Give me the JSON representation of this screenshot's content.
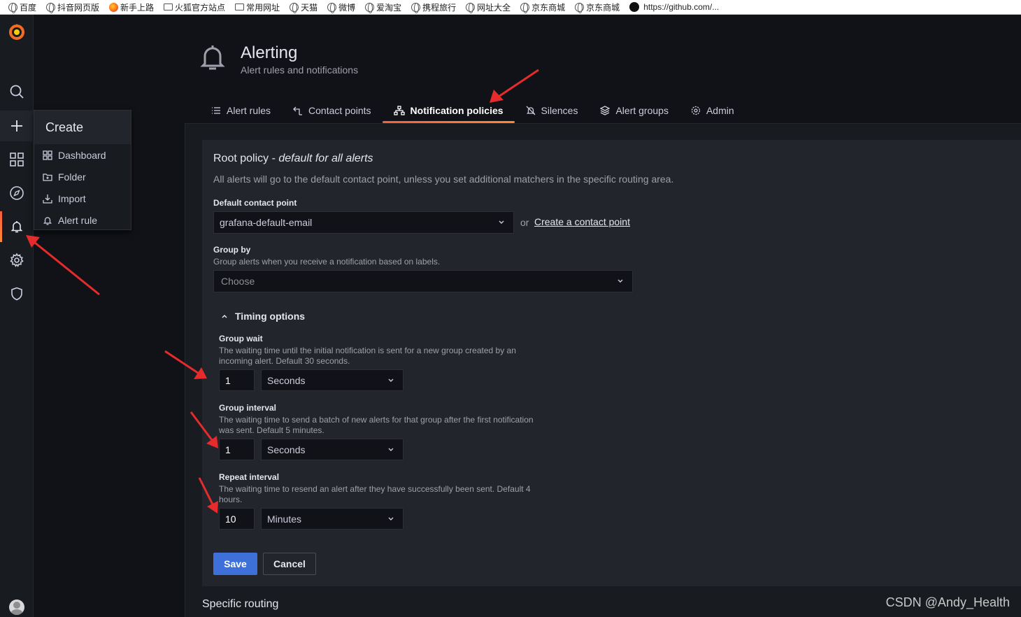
{
  "bookmarks": [
    {
      "label": "百度",
      "icon": "globe-icon"
    },
    {
      "label": "抖音网页版",
      "icon": "globe-icon"
    },
    {
      "label": "新手上路",
      "icon": "firefox-icon"
    },
    {
      "label": "火狐官方站点",
      "icon": "folder-icon"
    },
    {
      "label": "常用网址",
      "icon": "folder-icon"
    },
    {
      "label": "天猫",
      "icon": "globe-icon"
    },
    {
      "label": "微博",
      "icon": "globe-icon"
    },
    {
      "label": "爱淘宝",
      "icon": "globe-icon"
    },
    {
      "label": "携程旅行",
      "icon": "globe-icon"
    },
    {
      "label": "网址大全",
      "icon": "globe-icon"
    },
    {
      "label": "京东商城",
      "icon": "globe-icon"
    },
    {
      "label": "京东商城",
      "icon": "globe-icon"
    },
    {
      "label": "https://github.com/...",
      "icon": "github-icon"
    }
  ],
  "create_menu": {
    "title": "Create",
    "items": [
      {
        "label": "Dashboard",
        "icon": "apps-icon"
      },
      {
        "label": "Folder",
        "icon": "folder-plus-icon"
      },
      {
        "label": "Import",
        "icon": "import-icon"
      },
      {
        "label": "Alert rule",
        "icon": "bell-icon"
      }
    ]
  },
  "header": {
    "title": "Alerting",
    "subtitle": "Alert rules and notifications"
  },
  "tabs": [
    {
      "label": "Alert rules",
      "icon": "list-icon"
    },
    {
      "label": "Contact points",
      "icon": "comment-alt-share-icon"
    },
    {
      "label": "Notification policies",
      "icon": "sitemap-icon",
      "active": true
    },
    {
      "label": "Silences",
      "icon": "bell-slash-icon"
    },
    {
      "label": "Alert groups",
      "icon": "layer-group-icon"
    },
    {
      "label": "Admin",
      "icon": "cog-icon"
    }
  ],
  "policy": {
    "title": "Root policy - ",
    "title_emph": "default for all alerts",
    "description": "All alerts will go to the default contact point, unless you set additional matchers in the specific routing area.",
    "contact_label": "Default contact point",
    "contact_value": "grafana-default-email",
    "or_text": "or",
    "create_link": "Create a contact point",
    "group_by_label": "Group by",
    "group_by_desc": "Group alerts when you receive a notification based on labels.",
    "group_by_placeholder": "Choose",
    "timing_label": "Timing options",
    "group_wait": {
      "label": "Group wait",
      "desc_line1": "The waiting time until the initial notification is sent for a new group created by an",
      "desc_line2": "incoming alert. Default 30 seconds.",
      "value": "1",
      "unit": "Seconds"
    },
    "group_interval": {
      "label": "Group interval",
      "desc_line1": "The waiting time to send a batch of new alerts for that group after the first notification",
      "desc_line2": "was sent. Default 5 minutes.",
      "value": "1",
      "unit": "Seconds"
    },
    "repeat_interval": {
      "label": "Repeat interval",
      "desc_line1": "The waiting time to resend an alert after they have successfully been sent. Default 4",
      "desc_line2": "hours.",
      "value": "10",
      "unit": "Minutes"
    },
    "save_label": "Save",
    "cancel_label": "Cancel"
  },
  "specific_routing": "Specific routing",
  "watermark": "CSDN @Andy_Health",
  "colors": {
    "accent": "#f55f3e",
    "primary": "#3d71d9",
    "arrow": "#e52b2b"
  }
}
